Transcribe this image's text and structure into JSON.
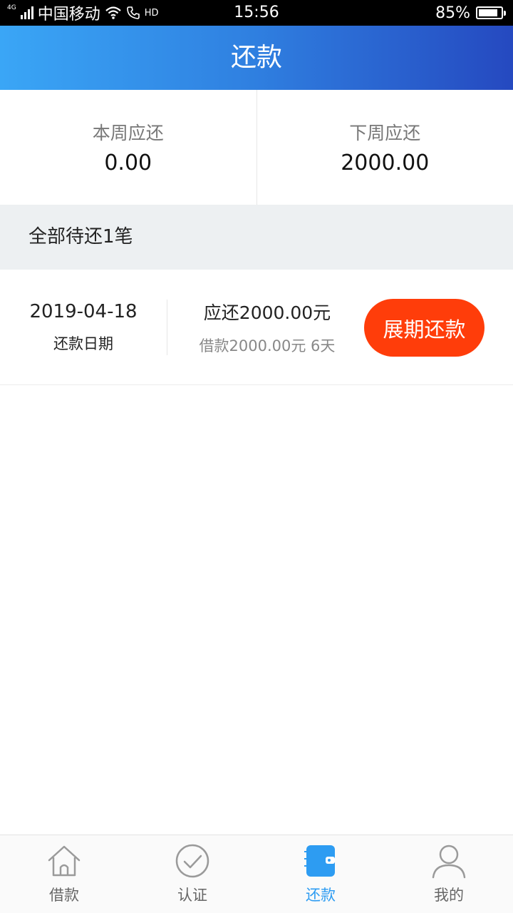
{
  "status_bar": {
    "network": "4G",
    "carrier": "中国移动",
    "hd": "HD",
    "time": "15:56",
    "battery": "85%",
    "battery_level": 0.85
  },
  "header": {
    "title": "还款"
  },
  "summary": {
    "this_week": {
      "label": "本周应还",
      "value": "0.00"
    },
    "next_week": {
      "label": "下周应还",
      "value": "2000.00"
    }
  },
  "section": {
    "title": "全部待还1笔"
  },
  "bill": {
    "date": "2019-04-18",
    "date_label": "还款日期",
    "due": "应还2000.00元",
    "sub": "借款2000.00元 6天",
    "action_label": "展期还款"
  },
  "tabbar": {
    "items": [
      {
        "label": "借款",
        "icon": "home-icon"
      },
      {
        "label": "认证",
        "icon": "check-circle-icon"
      },
      {
        "label": "还款",
        "icon": "wallet-icon",
        "active": true
      },
      {
        "label": "我的",
        "icon": "user-icon"
      }
    ]
  },
  "colors": {
    "header_start": "#3aa6f6",
    "header_end": "#2549c0",
    "accent": "#2d9cf2",
    "action": "#ff3d0a"
  }
}
